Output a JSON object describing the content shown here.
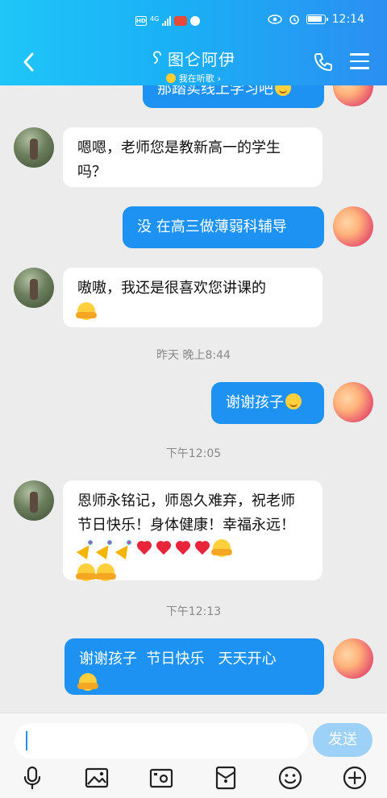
{
  "status_bar": {
    "network": "4G",
    "time": "12:14"
  },
  "header": {
    "title": "图仑阿伊",
    "subtitle": "我在听歌"
  },
  "messages": [
    {
      "side": "out",
      "text": "那踏实线上学习吧",
      "emoji": "smile"
    },
    {
      "side": "in",
      "text": "嗯嗯，老师您是教新高一的学生吗？"
    },
    {
      "side": "out",
      "text": "没 在高三做薄弱科辅导"
    },
    {
      "side": "in",
      "text": "嗷嗷，我还是很喜欢您讲课的",
      "emoji": "hug"
    },
    {
      "side": "out",
      "text": "谢谢孩子",
      "emoji": "smile"
    },
    {
      "side": "in",
      "text": "恩师永铭记，师恩久难弃，祝老师节日快乐！身体健康！幸福永远！",
      "emoji": "party-heart-hug"
    },
    {
      "side": "out",
      "text": "谢谢孩子  节日快乐   天天开心",
      "emoji": "hug"
    }
  ],
  "timestamps": {
    "t1": "昨天 晚上8:44",
    "t2": "下午12:05",
    "t3": "下午12:13"
  },
  "composer": {
    "placeholder": "",
    "send_label": "发送"
  },
  "toolbar": {
    "items": [
      "mic-icon",
      "image-icon",
      "camera-icon",
      "red-packet-icon",
      "emoji-icon",
      "plus-icon"
    ]
  },
  "colors": {
    "header_start": "#1fc6f8",
    "header_end": "#2b8ff2",
    "outgoing_bubble": "#1e92f3",
    "incoming_bubble": "#ffffff",
    "send_button": "#9dd1f8"
  }
}
